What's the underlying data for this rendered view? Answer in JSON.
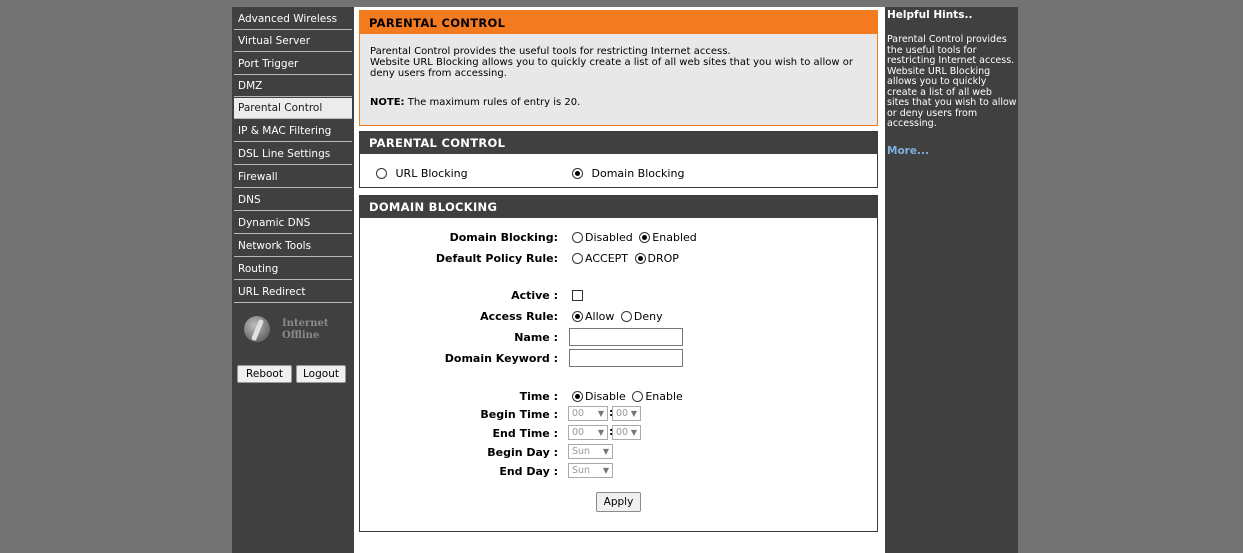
{
  "nav": {
    "items": [
      {
        "label": "Advanced Wireless"
      },
      {
        "label": "Virtual Server"
      },
      {
        "label": "Port Trigger"
      },
      {
        "label": "DMZ"
      },
      {
        "label": "Parental Control",
        "active": true
      },
      {
        "label": "IP & MAC Filtering"
      },
      {
        "label": "DSL Line Settings"
      },
      {
        "label": "Firewall"
      },
      {
        "label": "DNS"
      },
      {
        "label": "Dynamic DNS"
      },
      {
        "label": "Network Tools"
      },
      {
        "label": "Routing"
      },
      {
        "label": "URL Redirect"
      }
    ],
    "status": {
      "line1": "Internet",
      "line2": "Offline",
      "icon": "internet-offline-icon"
    },
    "reboot_label": "Reboot",
    "logout_label": "Logout"
  },
  "intro": {
    "title": "PARENTAL CONTROL",
    "line1": "Parental Control provides the useful tools for restricting Internet access.",
    "line2": "Website URL Blocking allows you to quickly create a list of all web sites that you wish to allow or deny users from accessing.",
    "note_label": "NOTE:",
    "note_text": " The maximum rules of entry is 20."
  },
  "parental_control": {
    "title": "PARENTAL CONTROL",
    "url_blocking_label": "URL Blocking",
    "domain_blocking_label": "Domain Blocking",
    "selected": "Domain Blocking"
  },
  "domain_blocking": {
    "title": "DOMAIN BLOCKING",
    "domain_blocking_label": "Domain Blocking:",
    "disabled_label": "Disabled",
    "enabled_label": "Enabled",
    "domain_blocking_value": "Enabled",
    "default_policy_label": "Default Policy Rule:",
    "accept_label": "ACCEPT",
    "drop_label": "DROP",
    "default_policy_value": "DROP",
    "active_label": "Active :",
    "active_checked": false,
    "access_rule_label": "Access Rule:",
    "allow_label": "Allow",
    "deny_label": "Deny",
    "access_rule_value": "Allow",
    "name_label": "Name :",
    "name_value": "",
    "keyword_label": "Domain Keyword :",
    "keyword_value": "",
    "time_label": "Time :",
    "time_disable_label": "Disable",
    "time_enable_label": "Enable",
    "time_value": "Disable",
    "begin_time_label": "Begin Time :",
    "begin_hour": "00",
    "begin_min": "00",
    "end_time_label": "End Time :",
    "end_hour": "00",
    "end_min": "00",
    "time_sep": ":",
    "begin_day_label": "Begin Day :",
    "begin_day": "Sun",
    "end_day_label": "End Day :",
    "end_day": "Sun",
    "apply_label": "Apply"
  },
  "hints": {
    "title": "Helpful Hints..",
    "text": "Parental Control provides the useful tools for restricting Internet access. Website URL Blocking allows you to quickly create a list of all web sites that you wish to allow or deny users from accessing.",
    "more_label": "More..."
  },
  "colors": {
    "accent_orange": "#f47a20",
    "dark_panel": "#404040",
    "page_bg": "#737373",
    "link": "#7fb0e0"
  }
}
